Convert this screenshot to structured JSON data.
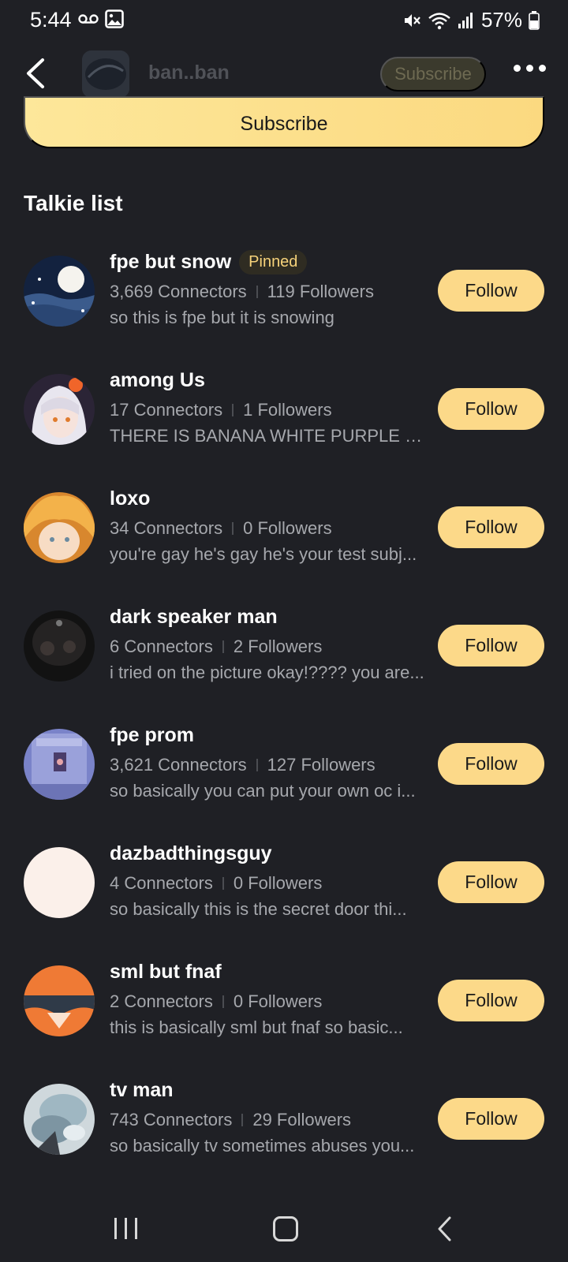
{
  "status_bar": {
    "time": "5:44",
    "battery": "57%"
  },
  "header": {
    "title": "ban..ban",
    "subscribe_label": "Subscribe"
  },
  "subscribe_banner": {
    "label": "Subscribe"
  },
  "section": {
    "title": "Talkie list"
  },
  "talkies": [
    {
      "name": "fpe but snow",
      "pinned": "Pinned",
      "connectors": "3,669 Connectors",
      "followers": "119 Followers",
      "description": "so this is fpe but it is snowing",
      "follow": "Follow"
    },
    {
      "name": "among Us",
      "connectors": "17 Connectors",
      "followers": "1 Followers",
      "description": "THERE IS BANANA WHITE PURPLE RE...",
      "follow": "Follow"
    },
    {
      "name": "loxo",
      "connectors": "34 Connectors",
      "followers": "0 Followers",
      "description": "you're gay he's gay he's your test subj...",
      "follow": "Follow"
    },
    {
      "name": "dark speaker man",
      "connectors": "6 Connectors",
      "followers": "2 Followers",
      "description": "i tried on the picture okay!???? you are...",
      "follow": "Follow"
    },
    {
      "name": "fpe prom",
      "connectors": "3,621 Connectors",
      "followers": "127 Followers",
      "description": "so basically you can put your own oc i...",
      "follow": "Follow"
    },
    {
      "name": "dazbadthingsguy",
      "connectors": "4 Connectors",
      "followers": "0 Followers",
      "description": "so basically this is the secret door thi...",
      "follow": "Follow"
    },
    {
      "name": "sml but fnaf",
      "connectors": "2 Connectors",
      "followers": "0 Followers",
      "description": "this is basically sml but fnaf so basic...",
      "follow": "Follow"
    },
    {
      "name": "tv man",
      "connectors": "743 Connectors",
      "followers": "29 Followers",
      "description": "so basically tv sometimes abuses you...",
      "follow": "Follow"
    }
  ]
}
